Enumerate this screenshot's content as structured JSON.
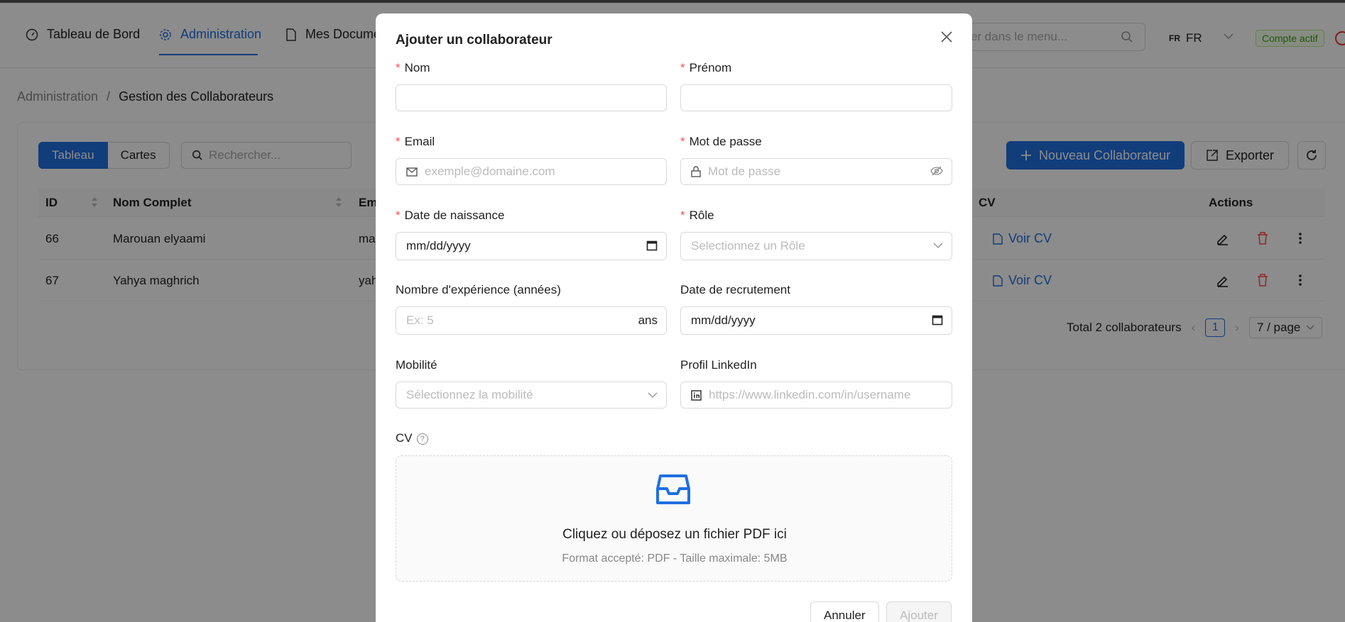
{
  "nav": {
    "items": [
      {
        "label": "Tableau de Bord",
        "icon": "dashboard-icon"
      },
      {
        "label": "Administration",
        "icon": "gear-icon"
      },
      {
        "label": "Mes Docume",
        "icon": "document-icon"
      }
    ],
    "search_placeholder": "cher dans le menu...",
    "lang_small": "FR",
    "lang": "FR",
    "account_status": "Compte actif"
  },
  "breadcrumb": {
    "parent": "Administration",
    "separator": "/",
    "current": "Gestion des Collaborateurs"
  },
  "toolbar": {
    "view_table": "Tableau",
    "view_cards": "Cartes",
    "search_placeholder": "Rechercher...",
    "new_label": "Nouveau Collaborateur",
    "export_label": "Exporter"
  },
  "table": {
    "headers": {
      "id": "ID",
      "name": "Nom Complet",
      "email": "Em",
      "cv": "CV",
      "actions": "Actions"
    },
    "rows": [
      {
        "id": "66",
        "name": "Marouan elyaami",
        "email": "ma",
        "cv": "Voir CV"
      },
      {
        "id": "67",
        "name": "Yahya maghrich",
        "email": "yah",
        "cv": "Voir CV"
      }
    ]
  },
  "pagination": {
    "total": "Total 2 collaborateurs",
    "page": "1",
    "page_size": "7 / page"
  },
  "modal": {
    "title": "Ajouter un collaborateur",
    "nom": {
      "label": "Nom",
      "value": ""
    },
    "prenom": {
      "label": "Prénom",
      "value": ""
    },
    "email": {
      "label": "Email",
      "placeholder": "exemple@domaine.com"
    },
    "password": {
      "label": "Mot de passe",
      "placeholder": "Mot de passe"
    },
    "birth": {
      "label": "Date de naissance",
      "value": "mm/dd/yyyy"
    },
    "role": {
      "label": "Rôle",
      "placeholder": "Selectionnez un Rôle"
    },
    "experience": {
      "label": "Nombre d'expérience (années)",
      "placeholder": "Ex: 5",
      "suffix": "ans"
    },
    "recruit": {
      "label": "Date de recrutement",
      "value": "mm/dd/yyyy"
    },
    "mobility": {
      "label": "Mobilité",
      "placeholder": "Sélectionnez la mobilité"
    },
    "linkedin": {
      "label": "Profil LinkedIn",
      "placeholder": "https://www.linkedin.com/in/username"
    },
    "cv": {
      "label": "CV",
      "help": "?",
      "upload_text": "Cliquez ou déposez un fichier PDF ici",
      "upload_hint": "Format accepté: PDF - Taille maximale: 5MB"
    },
    "cancel_label": "Annuler",
    "submit_label": "Ajouter"
  },
  "colors": {
    "primary": "#1f6fe0",
    "danger": "#ff4d4f",
    "success": "#389e0d"
  }
}
